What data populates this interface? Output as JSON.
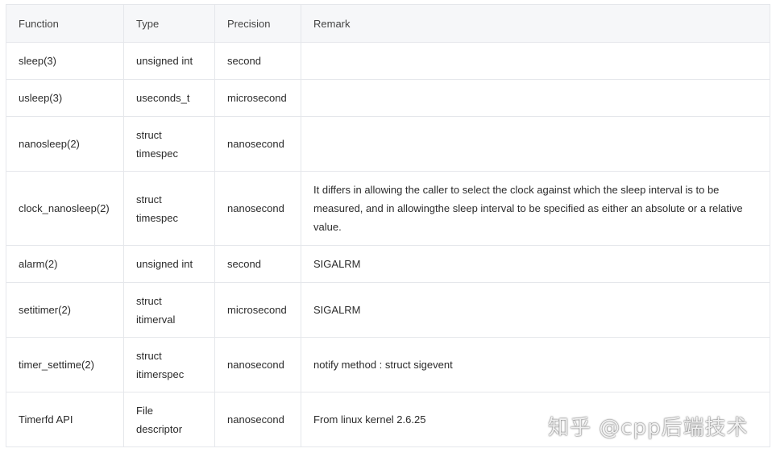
{
  "table": {
    "headers": [
      "Function",
      "Type",
      "Precision",
      "Remark"
    ],
    "rows": [
      {
        "function": "sleep(3)",
        "type": "unsigned int",
        "precision": "second",
        "remark": ""
      },
      {
        "function": "usleep(3)",
        "type": "useconds_t",
        "precision": "microsecond",
        "remark": ""
      },
      {
        "function": "nanosleep(2)",
        "type_line1": "struct",
        "type_line2": "timespec",
        "precision": "nanosecond",
        "remark": ""
      },
      {
        "function": "clock_nanosleep(2)",
        "type_line1": "struct",
        "type_line2": "timespec",
        "precision": "nanosecond",
        "remark": "It differs in allowing the caller to select the clock against which the sleep interval is to be measured, and in allowingthe sleep interval to be specified as either an absolute or a relative value."
      },
      {
        "function": "alarm(2)",
        "type": "unsigned int",
        "precision": "second",
        "remark": "SIGALRM"
      },
      {
        "function": "setitimer(2)",
        "type_line1": "struct",
        "type_line2": "itimerval",
        "precision": "microsecond",
        "remark": "SIGALRM"
      },
      {
        "function": "timer_settime(2)",
        "type_line1": "struct",
        "type_line2": "itimerspec",
        "precision": "nanosecond",
        "remark": "notify method : struct sigevent"
      },
      {
        "function": "Timerfd API",
        "type_line1": "File",
        "type_line2": "descriptor",
        "precision": "nanosecond",
        "remark": "From linux kernel 2.6.25"
      }
    ]
  },
  "watermark": "知乎 @cpp后端技术"
}
